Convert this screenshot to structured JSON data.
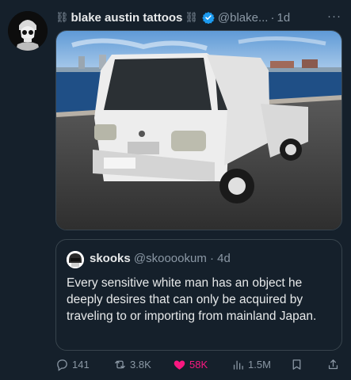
{
  "tweet": {
    "author_name": "blake austin tattoos",
    "name_decoration": "⛓",
    "handle": "@blake...",
    "separator": "·",
    "time": "1d",
    "more_label": "···",
    "media_description": "photo of a white mini kei truck parked by the waterfront"
  },
  "quote": {
    "author_name": "skooks",
    "handle": "@skooookum",
    "separator": "·",
    "time": "4d",
    "text": "Every sensitive white man has an object he deeply desires that can only be acquired by traveling to or importing from mainland Japan."
  },
  "actions": {
    "replies": "141",
    "reposts": "3.8K",
    "likes": "58K",
    "views": "1.5M"
  },
  "colors": {
    "background": "#15202b",
    "verified": "#1d9bf0",
    "like": "#f91880",
    "muted": "#8b98a5"
  }
}
